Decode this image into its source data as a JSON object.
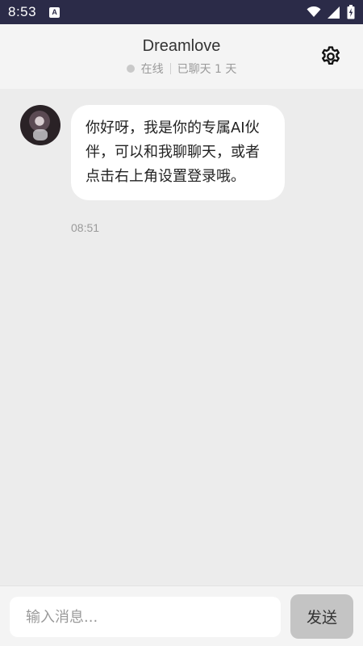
{
  "status_bar": {
    "time": "8:53",
    "app_icon_letter": "A",
    "icons": [
      "wifi-icon",
      "signal-icon",
      "battery-charging-icon"
    ]
  },
  "header": {
    "title": "Dreamlove",
    "status": "在线",
    "chat_duration": "已聊天 1 天",
    "settings_icon": "gear-icon"
  },
  "messages": [
    {
      "sender": "ai",
      "text": "你好呀，我是你的专属AI伙伴，可以和我聊聊天，或者点击右上角设置登录哦。",
      "time": "08:51"
    }
  ],
  "input": {
    "placeholder": "输入消息...",
    "send_label": "发送"
  },
  "colors": {
    "status_bar_bg": "#2b2b48",
    "chat_bg": "#ececec",
    "header_bg": "#f4f4f4",
    "bubble_bg": "#ffffff",
    "send_button_bg": "#c4c4c4",
    "muted_text": "#9a9a9a"
  }
}
